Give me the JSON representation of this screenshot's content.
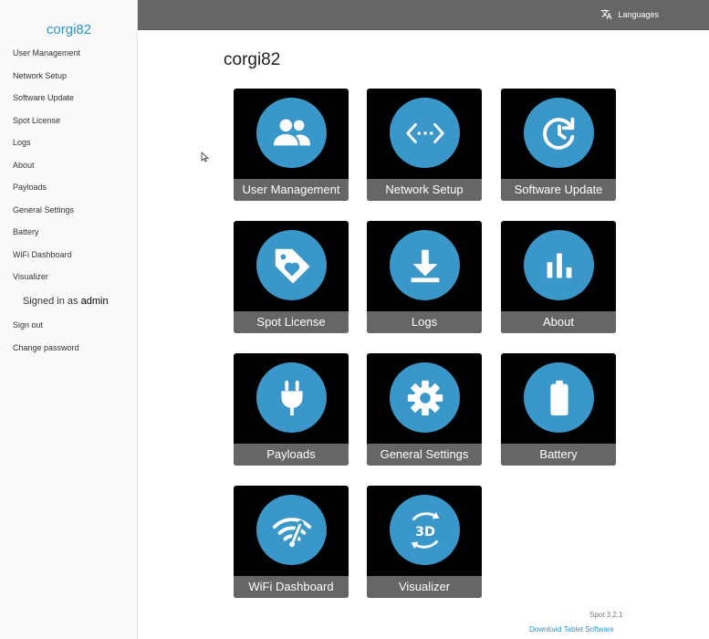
{
  "sidebar": {
    "brand": "corgi82",
    "items": [
      {
        "label": "User Management"
      },
      {
        "label": "Network Setup"
      },
      {
        "label": "Software Update"
      },
      {
        "label": "Spot License"
      },
      {
        "label": "Logs"
      },
      {
        "label": "About"
      },
      {
        "label": "Payloads"
      },
      {
        "label": "General Settings"
      },
      {
        "label": "Battery"
      },
      {
        "label": "WiFi Dashboard"
      },
      {
        "label": "Visualizer"
      }
    ],
    "signed_in_prefix": "Signed in as",
    "signed_in_user": "admin",
    "sign_out": "Sign out",
    "change_password": "Change password"
  },
  "topbar": {
    "languages_label": "Languages",
    "languages_icon": "translate-icon"
  },
  "main": {
    "title": "corgi82",
    "tiles": [
      {
        "label": "User Management",
        "icon": "users-icon"
      },
      {
        "label": "Network Setup",
        "icon": "network-code-icon"
      },
      {
        "label": "Software Update",
        "icon": "update-clock-icon"
      },
      {
        "label": "Spot License",
        "icon": "tag-heart-icon"
      },
      {
        "label": "Logs",
        "icon": "download-icon"
      },
      {
        "label": "About",
        "icon": "bar-chart-icon"
      },
      {
        "label": "Payloads",
        "icon": "plug-icon"
      },
      {
        "label": "General Settings",
        "icon": "gear-icon"
      },
      {
        "label": "Battery",
        "icon": "battery-icon"
      },
      {
        "label": "WiFi Dashboard",
        "icon": "wifi-gauge-icon"
      },
      {
        "label": "Visualizer",
        "icon": "3d-rotate-icon"
      }
    ]
  },
  "footer": {
    "version": "Spot 3.2.1",
    "download_link": "Download Tablet Software"
  },
  "colors": {
    "accent": "#3a97c9",
    "brand": "#2b96c9",
    "topbar": "#666666",
    "tile_bg": "#000000",
    "tile_label_bg": "#666666"
  }
}
